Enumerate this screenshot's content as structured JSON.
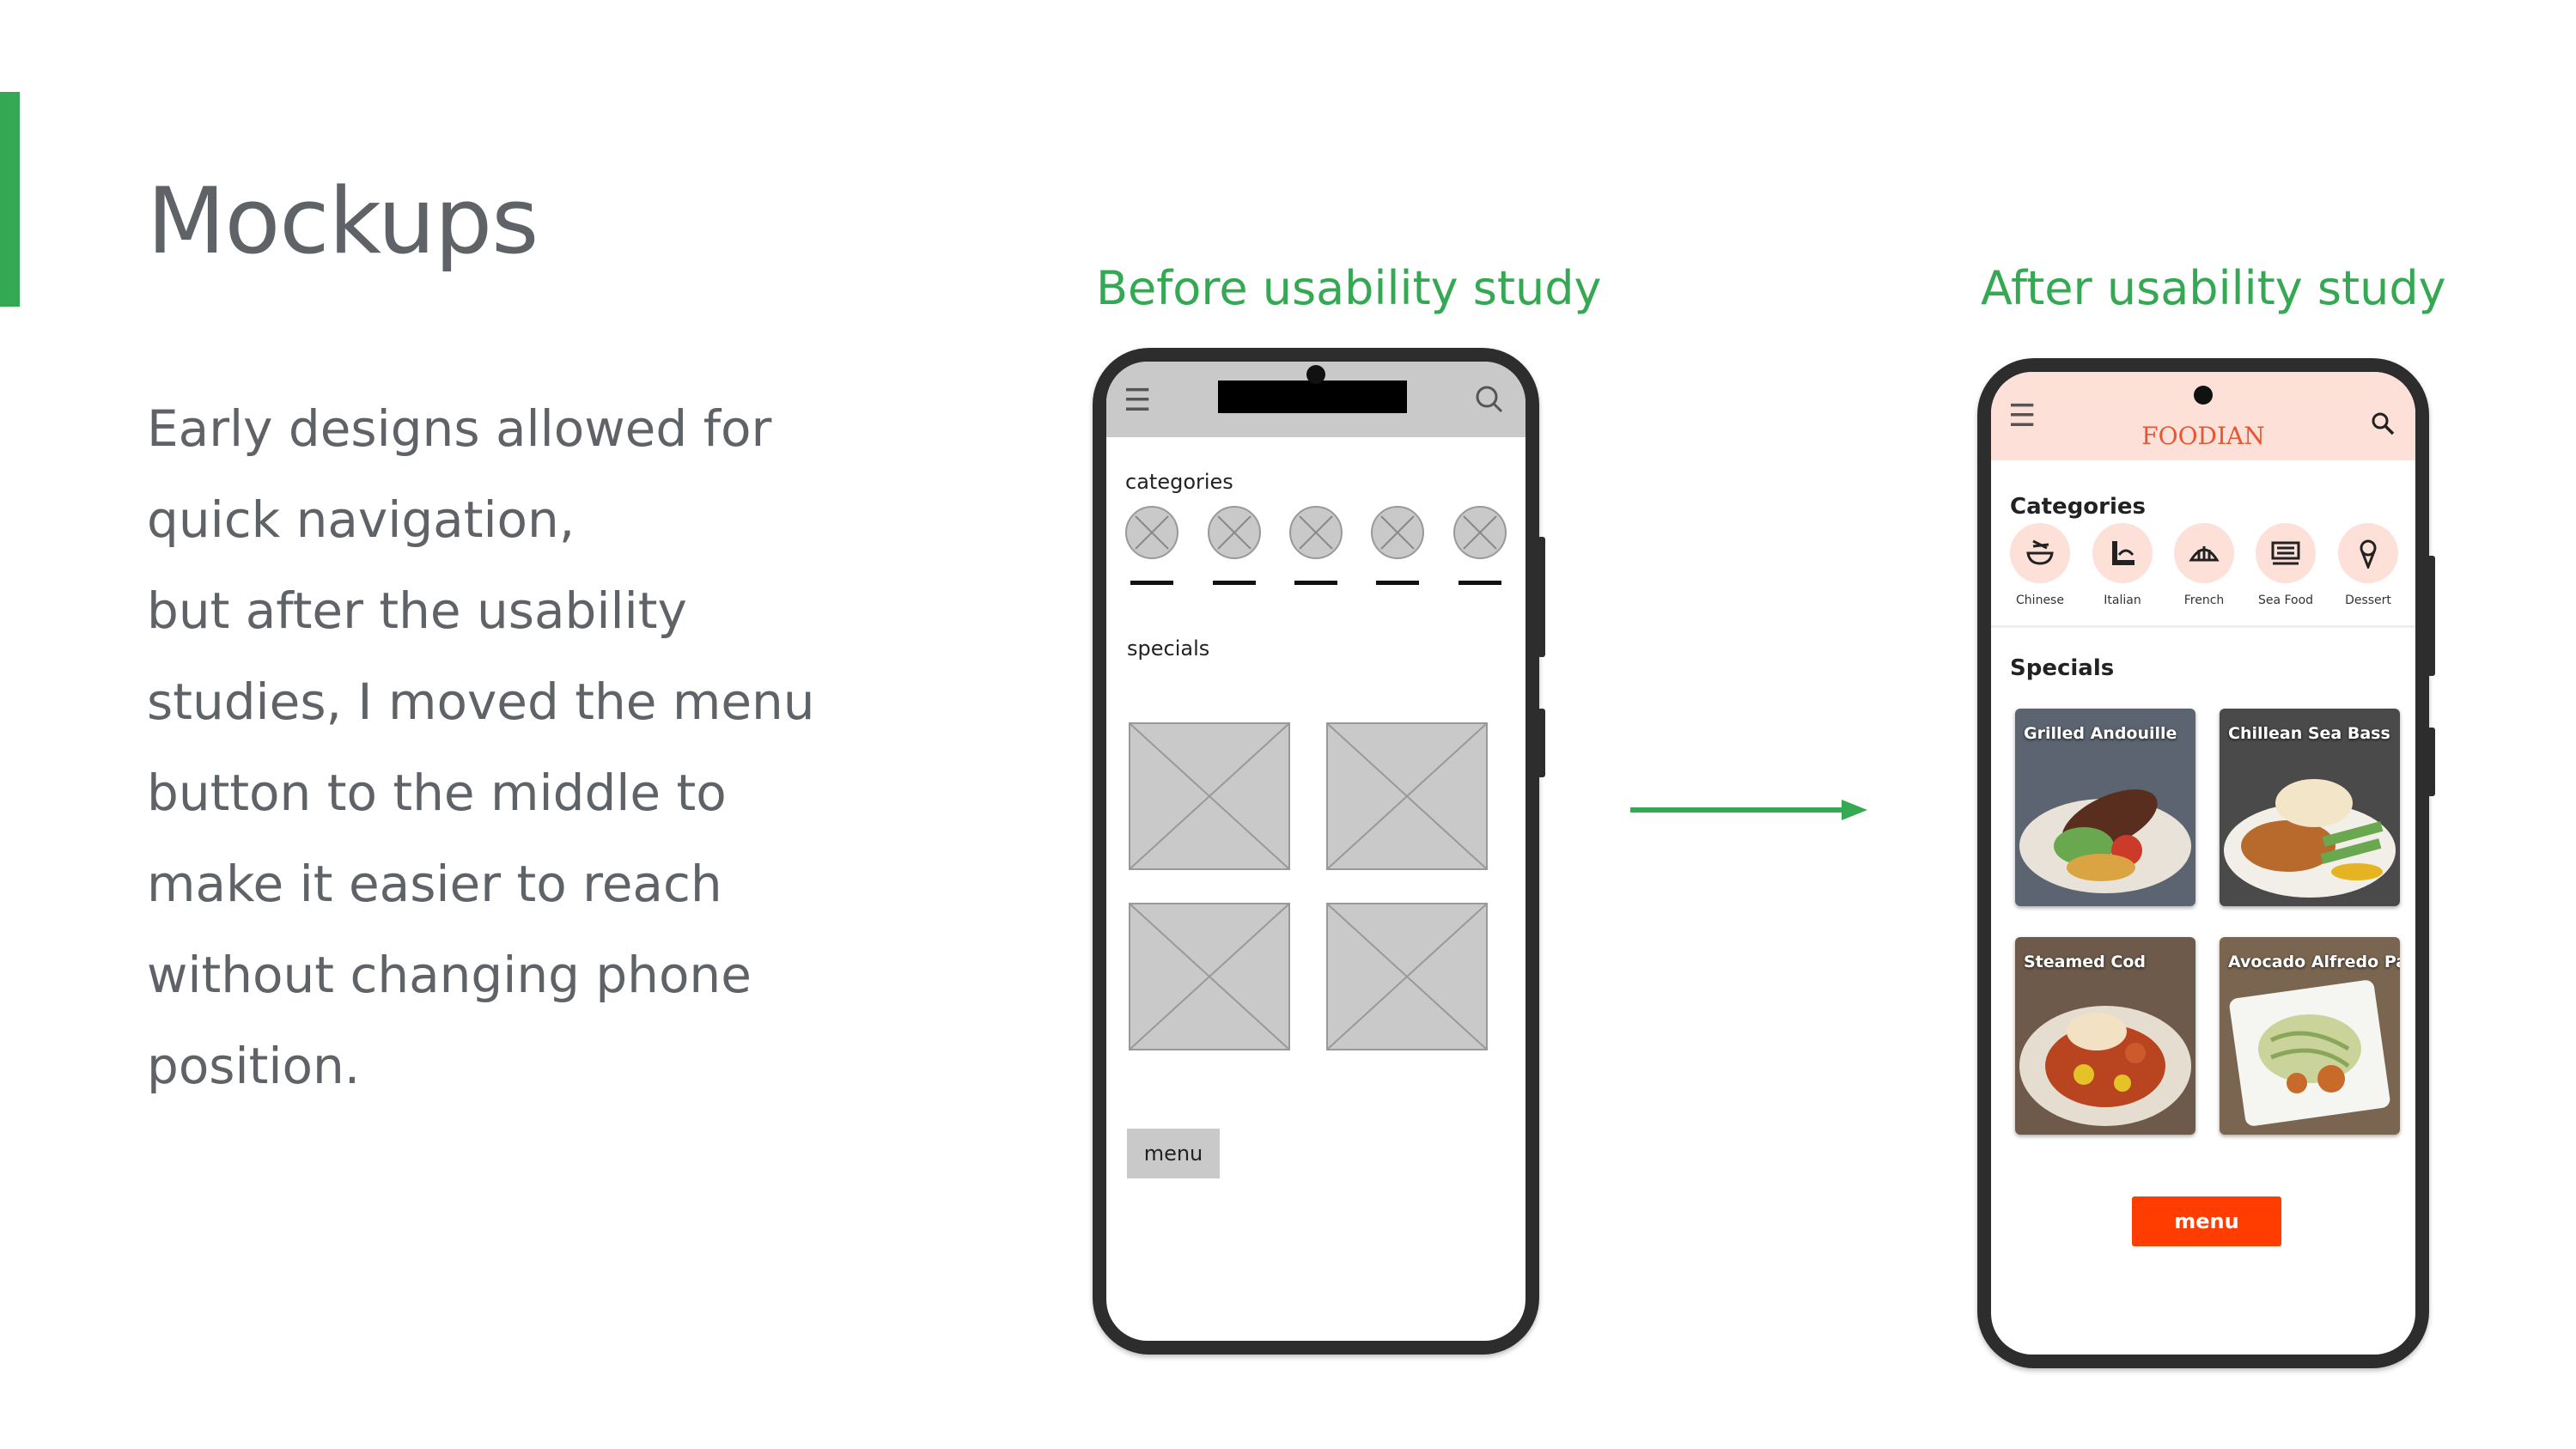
{
  "slide": {
    "title": "Mockups",
    "body_lines": [
      "Early designs allowed for",
      "quick navigation,",
      "but after the usability",
      "studies, I moved the menu",
      "button to the middle to",
      "make it easier to reach",
      "without changing phone",
      "position."
    ],
    "label_before": "Before usability study",
    "label_after": "After usability study",
    "accent_color": "#34a853",
    "text_color": "#5f6368"
  },
  "wireframe": {
    "categories_label": "categories",
    "specials_label": "specials",
    "menu_label": "menu",
    "icons": [
      "hamburger-icon",
      "search-icon"
    ]
  },
  "hifi": {
    "brand": "FOODIAN",
    "categories_label": "Categories",
    "categories": [
      {
        "label": "Chinese",
        "icon": "noodle-bowl-icon"
      },
      {
        "label": "Italian",
        "icon": "pasta-icon"
      },
      {
        "label": "French",
        "icon": "croissant-icon"
      },
      {
        "label": "Sea Food",
        "icon": "seafood-icon"
      },
      {
        "label": "Dessert",
        "icon": "ice-cream-icon"
      }
    ],
    "specials_label": "Specials",
    "specials": [
      {
        "name": "Grilled Andouille"
      },
      {
        "name": "Chillean Sea Bass"
      },
      {
        "name": "Steamed Cod"
      },
      {
        "name": "Avocado Alfredo Pasta"
      }
    ],
    "menu_label": "menu",
    "brand_color": "#e8552f",
    "header_color": "#fde0d8",
    "menu_color": "#ff3d00"
  }
}
